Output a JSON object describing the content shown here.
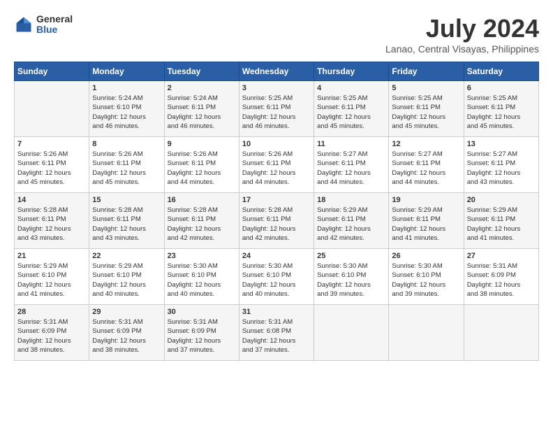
{
  "header": {
    "logo_general": "General",
    "logo_blue": "Blue",
    "month_title": "July 2024",
    "location": "Lanao, Central Visayas, Philippines"
  },
  "calendar": {
    "weekdays": [
      "Sunday",
      "Monday",
      "Tuesday",
      "Wednesday",
      "Thursday",
      "Friday",
      "Saturday"
    ],
    "weeks": [
      [
        {
          "day": "",
          "info": ""
        },
        {
          "day": "1",
          "info": "Sunrise: 5:24 AM\nSunset: 6:10 PM\nDaylight: 12 hours\nand 46 minutes."
        },
        {
          "day": "2",
          "info": "Sunrise: 5:24 AM\nSunset: 6:11 PM\nDaylight: 12 hours\nand 46 minutes."
        },
        {
          "day": "3",
          "info": "Sunrise: 5:25 AM\nSunset: 6:11 PM\nDaylight: 12 hours\nand 46 minutes."
        },
        {
          "day": "4",
          "info": "Sunrise: 5:25 AM\nSunset: 6:11 PM\nDaylight: 12 hours\nand 45 minutes."
        },
        {
          "day": "5",
          "info": "Sunrise: 5:25 AM\nSunset: 6:11 PM\nDaylight: 12 hours\nand 45 minutes."
        },
        {
          "day": "6",
          "info": "Sunrise: 5:25 AM\nSunset: 6:11 PM\nDaylight: 12 hours\nand 45 minutes."
        }
      ],
      [
        {
          "day": "7",
          "info": "Sunrise: 5:26 AM\nSunset: 6:11 PM\nDaylight: 12 hours\nand 45 minutes."
        },
        {
          "day": "8",
          "info": "Sunrise: 5:26 AM\nSunset: 6:11 PM\nDaylight: 12 hours\nand 45 minutes."
        },
        {
          "day": "9",
          "info": "Sunrise: 5:26 AM\nSunset: 6:11 PM\nDaylight: 12 hours\nand 44 minutes."
        },
        {
          "day": "10",
          "info": "Sunrise: 5:26 AM\nSunset: 6:11 PM\nDaylight: 12 hours\nand 44 minutes."
        },
        {
          "day": "11",
          "info": "Sunrise: 5:27 AM\nSunset: 6:11 PM\nDaylight: 12 hours\nand 44 minutes."
        },
        {
          "day": "12",
          "info": "Sunrise: 5:27 AM\nSunset: 6:11 PM\nDaylight: 12 hours\nand 44 minutes."
        },
        {
          "day": "13",
          "info": "Sunrise: 5:27 AM\nSunset: 6:11 PM\nDaylight: 12 hours\nand 43 minutes."
        }
      ],
      [
        {
          "day": "14",
          "info": "Sunrise: 5:28 AM\nSunset: 6:11 PM\nDaylight: 12 hours\nand 43 minutes."
        },
        {
          "day": "15",
          "info": "Sunrise: 5:28 AM\nSunset: 6:11 PM\nDaylight: 12 hours\nand 43 minutes."
        },
        {
          "day": "16",
          "info": "Sunrise: 5:28 AM\nSunset: 6:11 PM\nDaylight: 12 hours\nand 42 minutes."
        },
        {
          "day": "17",
          "info": "Sunrise: 5:28 AM\nSunset: 6:11 PM\nDaylight: 12 hours\nand 42 minutes."
        },
        {
          "day": "18",
          "info": "Sunrise: 5:29 AM\nSunset: 6:11 PM\nDaylight: 12 hours\nand 42 minutes."
        },
        {
          "day": "19",
          "info": "Sunrise: 5:29 AM\nSunset: 6:11 PM\nDaylight: 12 hours\nand 41 minutes."
        },
        {
          "day": "20",
          "info": "Sunrise: 5:29 AM\nSunset: 6:11 PM\nDaylight: 12 hours\nand 41 minutes."
        }
      ],
      [
        {
          "day": "21",
          "info": "Sunrise: 5:29 AM\nSunset: 6:10 PM\nDaylight: 12 hours\nand 41 minutes."
        },
        {
          "day": "22",
          "info": "Sunrise: 5:29 AM\nSunset: 6:10 PM\nDaylight: 12 hours\nand 40 minutes."
        },
        {
          "day": "23",
          "info": "Sunrise: 5:30 AM\nSunset: 6:10 PM\nDaylight: 12 hours\nand 40 minutes."
        },
        {
          "day": "24",
          "info": "Sunrise: 5:30 AM\nSunset: 6:10 PM\nDaylight: 12 hours\nand 40 minutes."
        },
        {
          "day": "25",
          "info": "Sunrise: 5:30 AM\nSunset: 6:10 PM\nDaylight: 12 hours\nand 39 minutes."
        },
        {
          "day": "26",
          "info": "Sunrise: 5:30 AM\nSunset: 6:10 PM\nDaylight: 12 hours\nand 39 minutes."
        },
        {
          "day": "27",
          "info": "Sunrise: 5:31 AM\nSunset: 6:09 PM\nDaylight: 12 hours\nand 38 minutes."
        }
      ],
      [
        {
          "day": "28",
          "info": "Sunrise: 5:31 AM\nSunset: 6:09 PM\nDaylight: 12 hours\nand 38 minutes."
        },
        {
          "day": "29",
          "info": "Sunrise: 5:31 AM\nSunset: 6:09 PM\nDaylight: 12 hours\nand 38 minutes."
        },
        {
          "day": "30",
          "info": "Sunrise: 5:31 AM\nSunset: 6:09 PM\nDaylight: 12 hours\nand 37 minutes."
        },
        {
          "day": "31",
          "info": "Sunrise: 5:31 AM\nSunset: 6:08 PM\nDaylight: 12 hours\nand 37 minutes."
        },
        {
          "day": "",
          "info": ""
        },
        {
          "day": "",
          "info": ""
        },
        {
          "day": "",
          "info": ""
        }
      ]
    ]
  }
}
